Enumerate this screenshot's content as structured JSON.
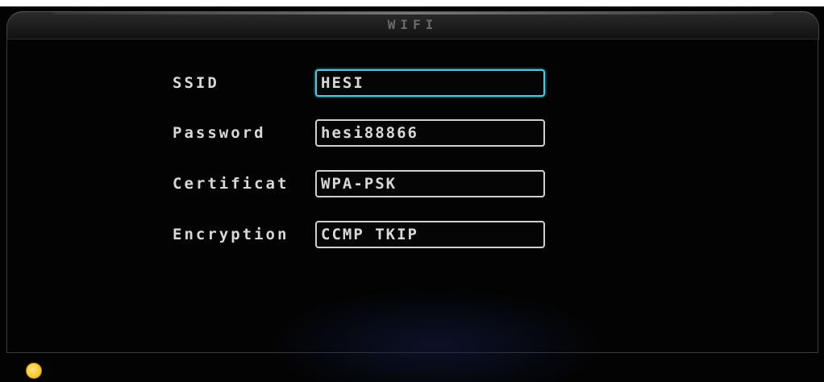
{
  "header": {
    "title": "WIFI"
  },
  "form": {
    "fields": [
      {
        "label": "SSID",
        "value": "HESI",
        "focused": true
      },
      {
        "label": "Password",
        "value": "hesi88866",
        "focused": false
      },
      {
        "label": "Certificat",
        "value": "WPA-PSK",
        "focused": false
      },
      {
        "label": "Encryption",
        "value": "CCMP TKIP",
        "focused": false
      }
    ]
  },
  "colors": {
    "background": "#030303",
    "text": "#d8d8d8",
    "focus_border": "#4fc6e0",
    "field_border": "#d0d0d0",
    "indicator": "#f2b70f"
  },
  "icons": {
    "status_indicator": "bulb-icon"
  }
}
